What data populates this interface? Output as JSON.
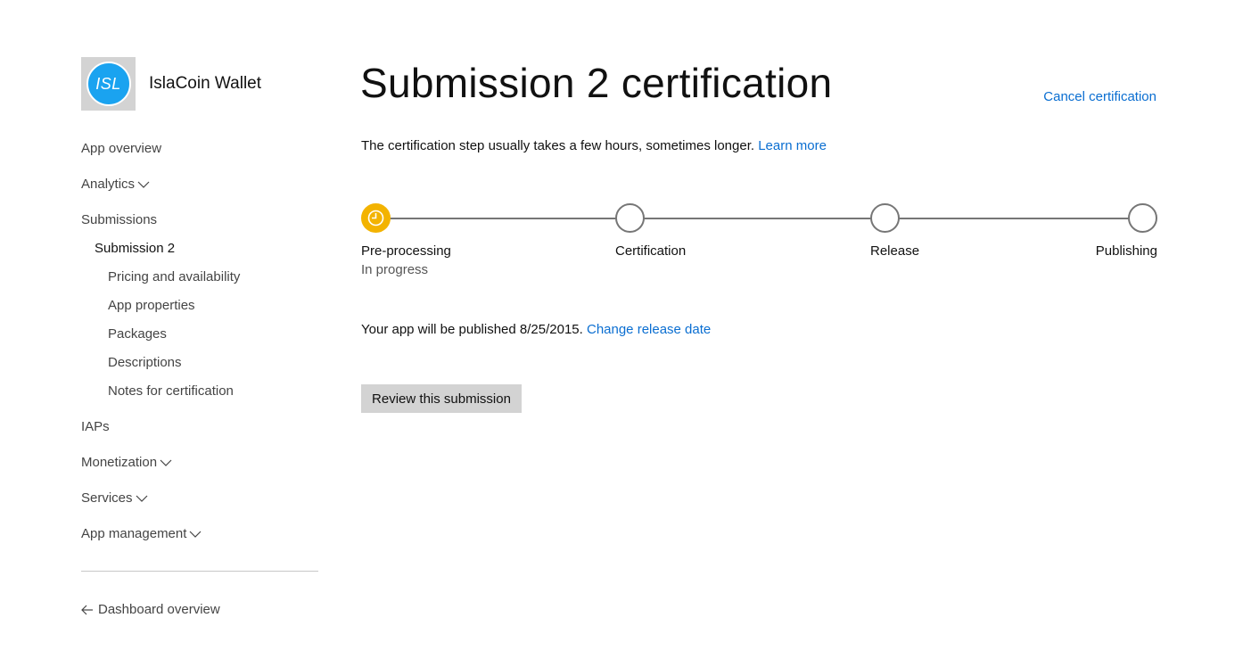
{
  "app": {
    "logo_text": "ISL",
    "name": "IslaCoin Wallet",
    "logo_color": "#1aa3f0"
  },
  "sidebar": {
    "items": [
      {
        "label": "App overview",
        "has_chevron": false
      },
      {
        "label": "Analytics",
        "has_chevron": true
      },
      {
        "label": "Submissions",
        "has_chevron": false
      },
      {
        "label": "Submission 2",
        "has_chevron": false
      },
      {
        "label": "Pricing and availability",
        "has_chevron": false
      },
      {
        "label": "App properties",
        "has_chevron": false
      },
      {
        "label": "Packages",
        "has_chevron": false
      },
      {
        "label": "Descriptions",
        "has_chevron": false
      },
      {
        "label": "Notes for certification",
        "has_chevron": false
      },
      {
        "label": "IAPs",
        "has_chevron": false
      },
      {
        "label": "Monetization",
        "has_chevron": true
      },
      {
        "label": "Services",
        "has_chevron": true
      },
      {
        "label": "App management",
        "has_chevron": true
      }
    ],
    "back_link": "Dashboard overview"
  },
  "main": {
    "title": "Submission 2 certification",
    "cancel_label": "Cancel certification",
    "intro_text": "The certification step usually takes a few hours, sometimes longer.",
    "learn_more": "Learn more",
    "steps": [
      {
        "label": "Pre-processing",
        "status": "In progress",
        "state": "active"
      },
      {
        "label": "Certification",
        "status": "",
        "state": "pending"
      },
      {
        "label": "Release",
        "status": "",
        "state": "pending"
      },
      {
        "label": "Publishing",
        "status": "",
        "state": "pending"
      }
    ],
    "publish_text": "Your app will be published 8/25/2015.",
    "change_release_date": "Change release date",
    "review_button": "Review this submission"
  },
  "colors": {
    "link": "#0a6ed1",
    "active_step": "#f3b300",
    "button_bg": "#d3d3d3"
  }
}
